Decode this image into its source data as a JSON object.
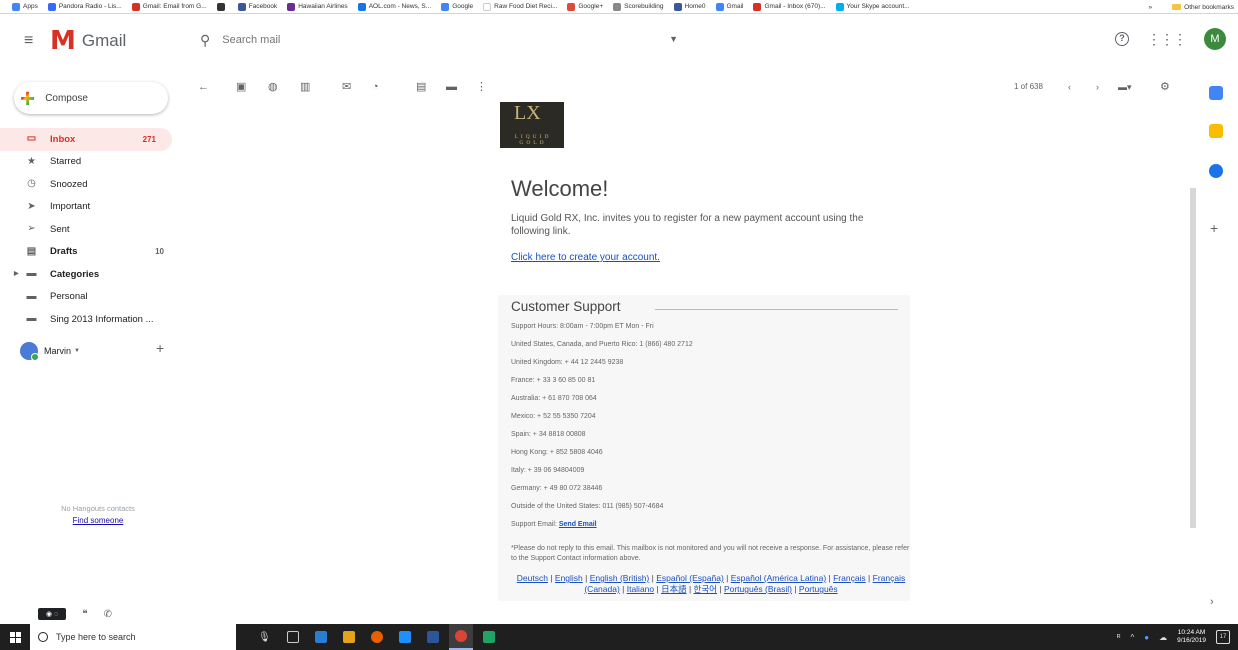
{
  "bookmarks": {
    "items": [
      {
        "label": "Apps",
        "color": "#4285f4"
      },
      {
        "label": "Pandora Radio - Lis...",
        "color": "#3668ff"
      },
      {
        "label": "Gmail: Email from G...",
        "color": "#d93025"
      },
      {
        "label": "",
        "color": "#333333"
      },
      {
        "label": "Facebook",
        "color": "#3b5998"
      },
      {
        "label": "Hawaiian Airlines",
        "color": "#6b2d8f"
      },
      {
        "label": "AOL.com - News, S...",
        "color": "#1a73e8"
      },
      {
        "label": "Google",
        "color": "#4285f4"
      },
      {
        "label": "Raw Food Diet Reci...",
        "color": "#ffffff"
      },
      {
        "label": "Google+",
        "color": "#dd4b39"
      },
      {
        "label": "Scorebuilding",
        "color": "#888888"
      },
      {
        "label": "Home0",
        "color": "#3b5998"
      },
      {
        "label": "Gmail",
        "color": "#4285f4"
      },
      {
        "label": "Gmail - Inbox (670)...",
        "color": "#d93025"
      },
      {
        "label": "Your Skype account...",
        "color": "#00aff0"
      }
    ],
    "overflow": "»",
    "other": "Other bookmarks"
  },
  "header": {
    "app_name": "Gmail",
    "search_placeholder": "Search mail",
    "avatar_letter": "M"
  },
  "compose": {
    "label": "Compose"
  },
  "nav": {
    "items": [
      {
        "label": "Inbox",
        "count": "271",
        "icon": "inbox-icon",
        "glyph": "▭"
      },
      {
        "label": "Starred",
        "count": "",
        "icon": "star-icon",
        "glyph": "★"
      },
      {
        "label": "Snoozed",
        "count": "",
        "icon": "clock-icon",
        "glyph": "◷"
      },
      {
        "label": "Important",
        "count": "",
        "icon": "important-icon",
        "glyph": "➤"
      },
      {
        "label": "Sent",
        "count": "",
        "icon": "send-icon",
        "glyph": "➢"
      },
      {
        "label": "Drafts",
        "count": "10",
        "icon": "draft-icon",
        "glyph": "▤"
      },
      {
        "label": "Categories",
        "count": "",
        "icon": "label-icon",
        "glyph": "▬"
      },
      {
        "label": "Personal",
        "count": "",
        "icon": "label-icon",
        "glyph": "▬"
      },
      {
        "label": "Sing 2013 Information ...",
        "count": "",
        "icon": "label-icon",
        "glyph": "▬"
      }
    ]
  },
  "hangouts": {
    "user": "Marvin",
    "empty_text": "No Hangouts contacts",
    "find_link": "Find someone"
  },
  "toolbar": {
    "pager": "1 of 638"
  },
  "email": {
    "brand_mark": "LX",
    "brand_sub": "LIQUID GOLD",
    "welcome": "Welcome!",
    "intro": "Liquid Gold RX, Inc. invites you to register for a new payment account using the following link.",
    "create_link": "Click here to create your account.",
    "support_title": "Customer Support",
    "support_lines": [
      "Support Hours: 8:00am - 7:00pm ET Mon - Fri",
      "United States, Canada, and Puerto Rico: 1 (866) 480 2712",
      "United Kingdom: + 44 12 2445 9238",
      "France: + 33 3 60 85 00 81",
      "Australia: + 61 870 708 064",
      "Mexico: + 52 55 5350 7204",
      "Spain: + 34 8818 00808",
      "Hong Kong: + 852 5808 4046",
      "Italy: + 39 06 94804009",
      "Germany: + 49 80 072 38446",
      "Outside of the United States: 011 (985) 507-4684"
    ],
    "support_email_label": "Support Email:",
    "support_email_link": "Send Email",
    "disclaimer": "*Please do not reply to this email. This mailbox is not monitored and you will not receive a response. For assistance, please refer to the Support Contact information above.",
    "languages": [
      "Deutsch",
      "English",
      "English (British)",
      "Español (España)",
      "Español (América Latina)",
      "Français",
      "Français (Canada)",
      "Italiano",
      "日本語",
      "한국어",
      "Português (Brasil)",
      "Português"
    ]
  },
  "taskbar": {
    "search_placeholder": "Type here to search",
    "time": "10:24 AM",
    "date": "9/16/2019",
    "notification_count": "17",
    "app_colors": [
      "#2b7cd3",
      "#e5a21b",
      "#e66000",
      "#1e90ff",
      "#2b579a",
      "#db4437",
      "#21a366"
    ]
  },
  "colors": {
    "gmail_red": "#d93025",
    "link_blue": "#1a4fbf",
    "taskbar": "#1f1f1f"
  }
}
